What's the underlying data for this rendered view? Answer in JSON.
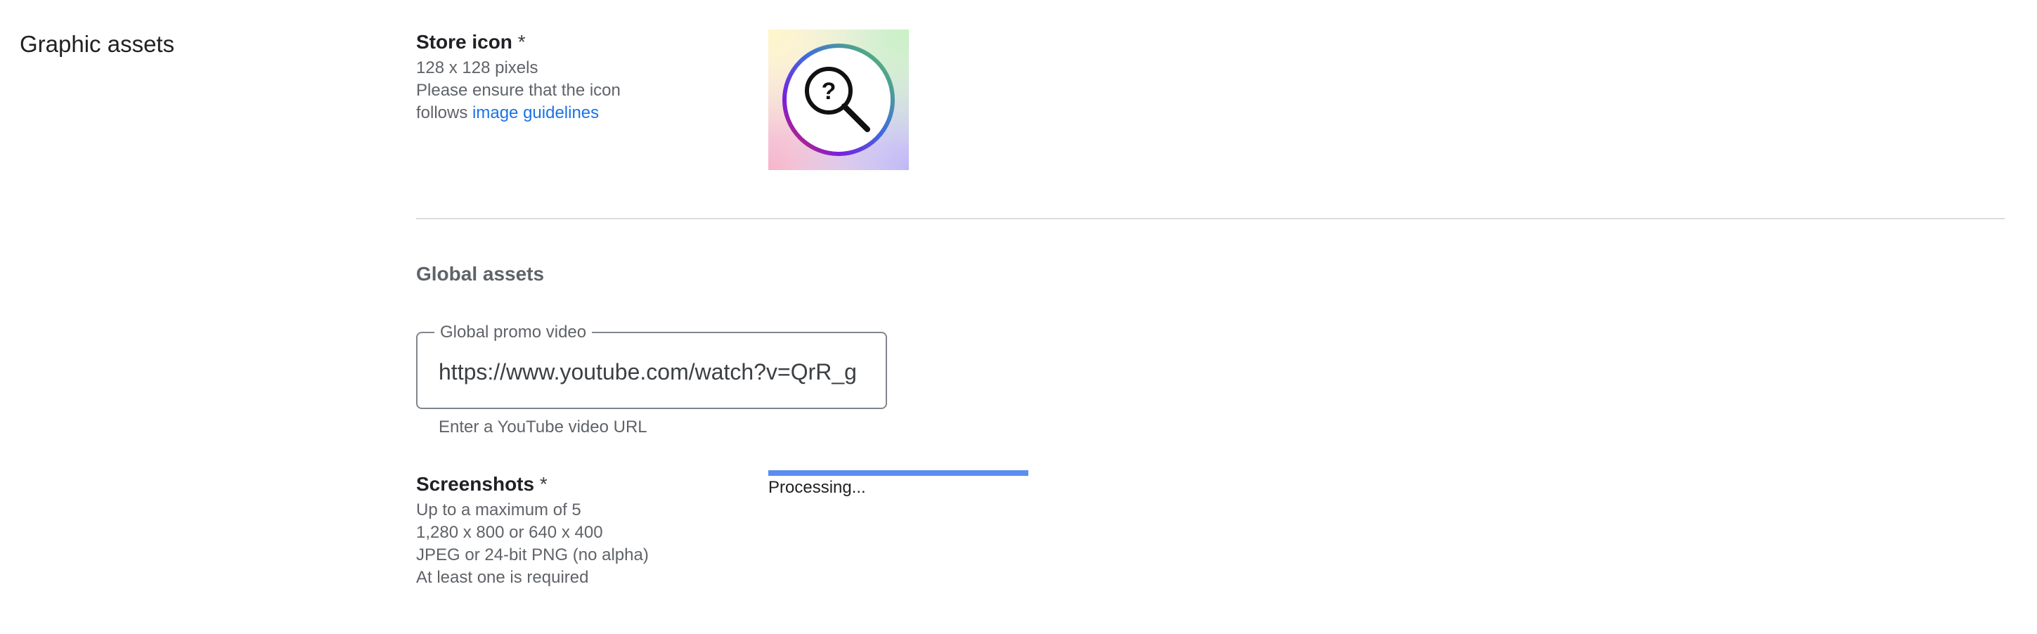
{
  "section": {
    "title": "Graphic assets"
  },
  "store_icon": {
    "label": "Store icon",
    "required_marker": "*",
    "hint_line1": "128 x 128 pixels",
    "hint_line2": "Please ensure that the icon",
    "hint_line3_prefix": "follows ",
    "link_text": "image guidelines",
    "image_icon": "magnifier-question-icon"
  },
  "global_assets": {
    "title": "Global assets",
    "promo_video": {
      "label": "Global promo video",
      "value": "https://www.youtube.com/watch?v=QrR_g",
      "helper": "Enter a YouTube video URL"
    }
  },
  "screenshots": {
    "label": "Screenshots",
    "required_marker": "*",
    "hints": [
      "Up to a maximum of 5",
      "1,280 x 800 or 640 x 400",
      "JPEG or 24-bit PNG (no alpha)",
      "At least one is required"
    ],
    "status": "Processing...",
    "progress_fraction": 1.0
  },
  "colors": {
    "link": "#1a73e8",
    "progress": "#5b8ef0",
    "divider": "#dadce0"
  }
}
